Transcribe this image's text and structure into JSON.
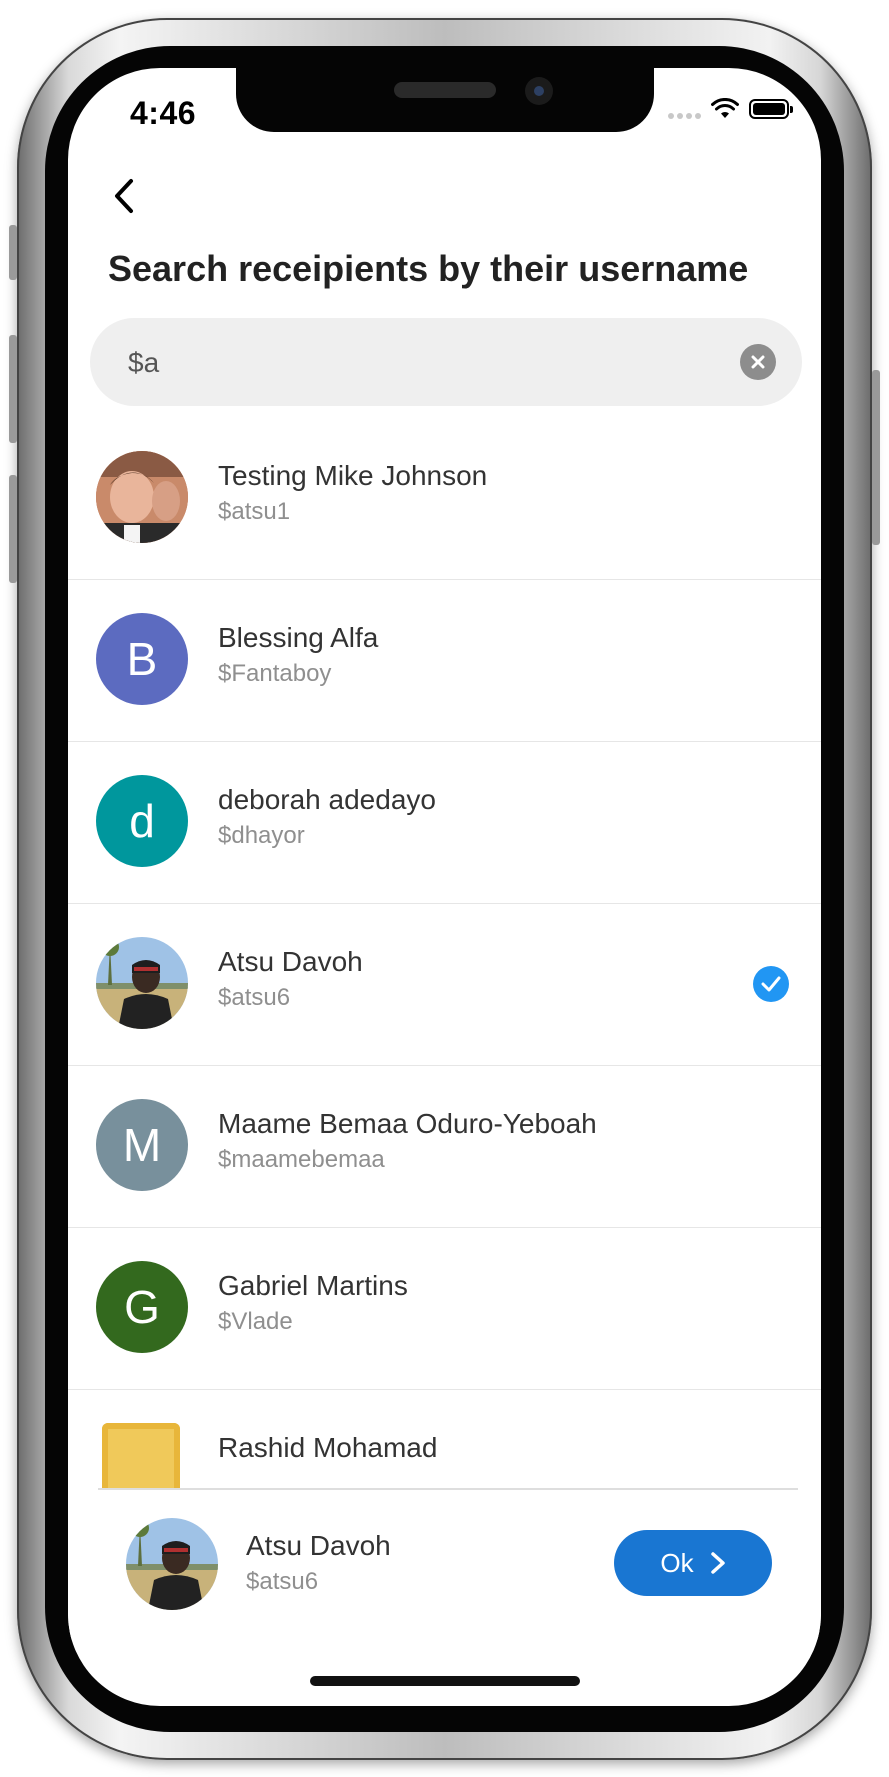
{
  "status_bar": {
    "time": "4:46"
  },
  "header": {
    "back_icon": "chevron-left-icon",
    "title": "Search receipients by their username"
  },
  "search": {
    "value": "$a",
    "placeholder": "",
    "clear_icon": "clear-icon"
  },
  "recipients": [
    {
      "name": "Testing Mike Johnson",
      "username": "$atsu1",
      "avatar_type": "photo",
      "selected": false
    },
    {
      "name": "Blessing Alfa",
      "username": "$Fantaboy",
      "avatar_type": "initial",
      "initial": "B",
      "color": "#5c6bc0",
      "selected": false
    },
    {
      "name": "deborah adedayo",
      "username": "$dhayor",
      "avatar_type": "initial",
      "initial": "d",
      "color": "#00979d",
      "selected": false
    },
    {
      "name": "Atsu Davoh",
      "username": "$atsu6",
      "avatar_type": "photo",
      "selected": true
    },
    {
      "name": "Maame Bemaa Oduro-Yeboah",
      "username": "$maamebemaa",
      "avatar_type": "initial",
      "initial": "M",
      "color": "#78909c",
      "selected": false
    },
    {
      "name": "Gabriel Martins",
      "username": "$Vlade",
      "avatar_type": "initial",
      "initial": "G",
      "color": "#33691e",
      "selected": false
    },
    {
      "name": "Rashid Mohamad",
      "username": "",
      "avatar_type": "photo",
      "selected": false
    }
  ],
  "selected_recipient": {
    "name": "Atsu Davoh",
    "username": "$atsu6"
  },
  "ok_button": {
    "label": "Ok",
    "icon": "chevron-right-icon"
  },
  "colors": {
    "accent": "#1976d2",
    "check": "#2196f3"
  }
}
